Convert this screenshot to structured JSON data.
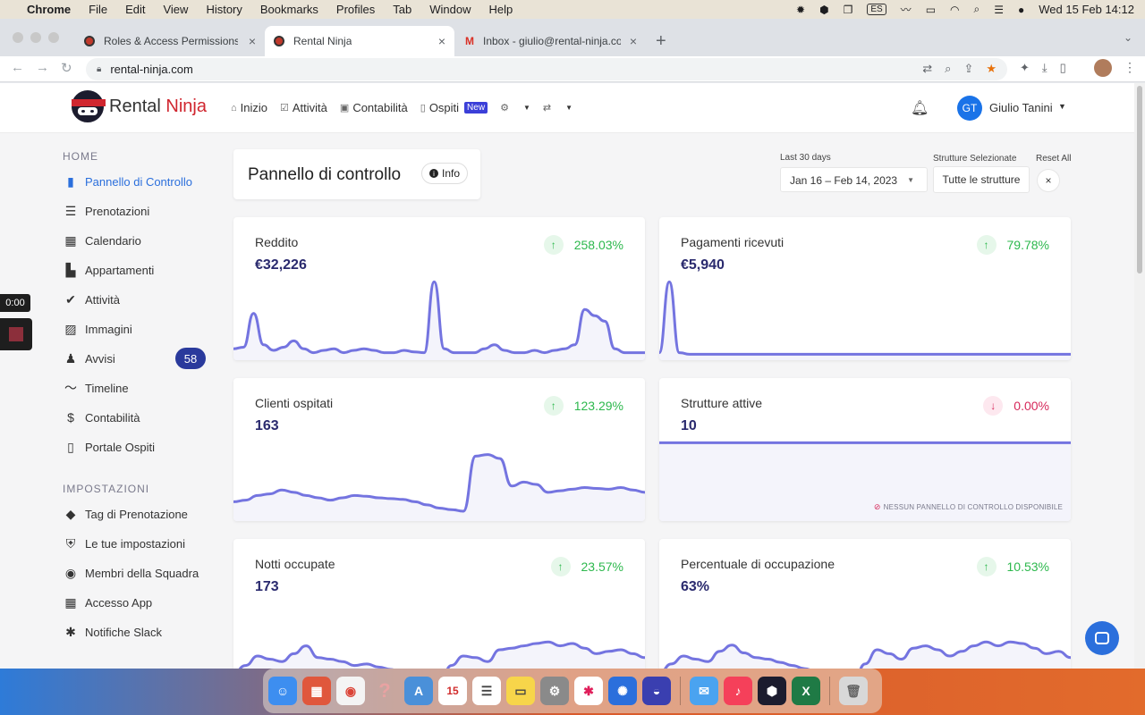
{
  "menubar": {
    "app": "Chrome",
    "items": [
      "File",
      "Edit",
      "View",
      "History",
      "Bookmarks",
      "Profiles",
      "Tab",
      "Window",
      "Help"
    ],
    "input_source": "ES",
    "clock": "Wed 15 Feb  14:12"
  },
  "browser": {
    "tabs": [
      {
        "title": "Roles & Access Permissions | R",
        "active": false
      },
      {
        "title": "Rental Ninja",
        "active": true
      },
      {
        "title": "Inbox - giulio@rental-ninja.com",
        "active": false
      }
    ],
    "url": "rental-ninja.com"
  },
  "app": {
    "brand_a": "Rental",
    "brand_b": "Ninja",
    "nav": [
      {
        "label": "Inizio",
        "icon": "home-icon"
      },
      {
        "label": "Attività",
        "icon": "checkbox-icon"
      },
      {
        "label": "Contabilità",
        "icon": "money-icon"
      },
      {
        "label": "Ospiti",
        "icon": "phone-icon"
      }
    ],
    "new_badge": "New",
    "user_initials": "GT",
    "user_name": "Giulio Tanini"
  },
  "sidebar": {
    "home_title": "HOME",
    "home_items": [
      {
        "label": "Pannello di Controllo",
        "icon": "bar-chart-icon",
        "active": true
      },
      {
        "label": "Prenotazioni",
        "icon": "list-icon"
      },
      {
        "label": "Calendario",
        "icon": "calendar-icon"
      },
      {
        "label": "Appartamenti",
        "icon": "building-icon"
      },
      {
        "label": "Attività",
        "icon": "double-check-icon"
      },
      {
        "label": "Immagini",
        "icon": "image-icon"
      },
      {
        "label": "Avvisi",
        "icon": "alarm-bell-icon",
        "badge": "58"
      },
      {
        "label": "Timeline",
        "icon": "trend-line-icon"
      },
      {
        "label": "Contabilità",
        "icon": "dollar-icon"
      },
      {
        "label": "Portale Ospiti",
        "icon": "mobile-icon"
      }
    ],
    "settings_title": "IMPOSTAZIONI",
    "settings_items": [
      {
        "label": "Tag di Prenotazione",
        "icon": "tag-icon"
      },
      {
        "label": "Le tue impostazioni",
        "icon": "shield-icon"
      },
      {
        "label": "Membri della Squadra",
        "icon": "team-icon"
      },
      {
        "label": "Accesso App",
        "icon": "qr-icon"
      },
      {
        "label": "Notifiche Slack",
        "icon": "slack-icon"
      }
    ]
  },
  "recorder": {
    "time": "0:00"
  },
  "dashboard": {
    "title": "Pannello di controllo",
    "info_label": "Info",
    "range_label": "Last 30 days",
    "date_range": "Jan 16 – Feb 14, 2023",
    "structures_label": "Strutture Selezionate",
    "structures_value": "Tutte le strutture",
    "reset_label": "Reset All",
    "reset_x": "×",
    "no_dashboard": "NESSUN PANNELLO DI CONTROLLO DISPONIBILE",
    "accent_color": "#7474e0",
    "positive_color": "#2db84d",
    "negative_color": "#d6285a"
  },
  "cards": [
    {
      "title": "Reddito",
      "value": "€32,226",
      "change": "258.03%",
      "direction": "up",
      "spark": [
        0.1,
        0.12,
        0.55,
        0.15,
        0.08,
        0.12,
        0.2,
        0.1,
        0.05,
        0.08,
        0.1,
        0.05,
        0.08,
        0.1,
        0.08,
        0.05,
        0.05,
        0.08,
        0.06,
        0.05,
        0.95,
        0.1,
        0.05,
        0.05,
        0.05,
        0.1,
        0.15,
        0.08,
        0.05,
        0.05,
        0.08,
        0.05,
        0.08,
        0.1,
        0.15,
        0.6,
        0.52,
        0.45,
        0.1,
        0.05,
        0.05,
        0.05
      ]
    },
    {
      "title": "Pagamenti ricevuti",
      "value": "€5,940",
      "change": "79.78%",
      "direction": "up",
      "spark": [
        0.05,
        0.95,
        0.05,
        0.03,
        0.03,
        0.03,
        0.03,
        0.03,
        0.03,
        0.03,
        0.03,
        0.03,
        0.03,
        0.03,
        0.03,
        0.03,
        0.03,
        0.03,
        0.03,
        0.03,
        0.03,
        0.03,
        0.03,
        0.03,
        0.03,
        0.03,
        0.03,
        0.03,
        0.03,
        0.03,
        0.03,
        0.03,
        0.03,
        0.03,
        0.03,
        0.03,
        0.03,
        0.03,
        0.03,
        0.03,
        0.03,
        0.03
      ]
    },
    {
      "title": "Clienti ospitati",
      "value": "163",
      "change": "123.29%",
      "direction": "up",
      "spark": [
        0.2,
        0.22,
        0.28,
        0.3,
        0.35,
        0.32,
        0.28,
        0.25,
        0.22,
        0.25,
        0.28,
        0.27,
        0.25,
        0.24,
        0.23,
        0.2,
        0.16,
        0.12,
        0.1,
        0.08,
        0.78,
        0.8,
        0.75,
        0.4,
        0.45,
        0.42,
        0.32,
        0.34,
        0.36,
        0.38,
        0.37,
        0.36,
        0.38,
        0.35,
        0.32
      ]
    },
    {
      "title": "Strutture attive",
      "value": "10",
      "change": "0.00%",
      "direction": "down",
      "spark": [
        0.95,
        0.95,
        0.95,
        0.95,
        0.95,
        0.95,
        0.95,
        0.95,
        0.95,
        0.95,
        0.95,
        0.95,
        0.95,
        0.95,
        0.95,
        0.95,
        0.95,
        0.95,
        0.95,
        0.95
      ]
    },
    {
      "title": "Notti occupate",
      "value": "173",
      "change": "23.57%",
      "direction": "up",
      "spark": [
        0.2,
        0.3,
        0.42,
        0.38,
        0.35,
        0.45,
        0.55,
        0.4,
        0.38,
        0.35,
        0.3,
        0.32,
        0.28,
        0.25,
        0.2,
        0.15,
        0.1,
        0.05,
        0.3,
        0.42,
        0.4,
        0.35,
        0.5,
        0.52,
        0.55,
        0.58,
        0.6,
        0.55,
        0.58,
        0.52,
        0.45,
        0.48,
        0.5,
        0.45,
        0.4
      ]
    },
    {
      "title": "Percentuale di occupazione",
      "value": "63%",
      "change": "10.53%",
      "direction": "up",
      "spark": [
        0.2,
        0.32,
        0.42,
        0.38,
        0.35,
        0.48,
        0.56,
        0.46,
        0.4,
        0.38,
        0.34,
        0.3,
        0.26,
        0.22,
        0.18,
        0.12,
        0.06,
        0.32,
        0.5,
        0.45,
        0.38,
        0.52,
        0.55,
        0.5,
        0.42,
        0.48,
        0.55,
        0.6,
        0.55,
        0.6,
        0.58,
        0.52,
        0.45,
        0.48,
        0.4
      ]
    }
  ]
}
